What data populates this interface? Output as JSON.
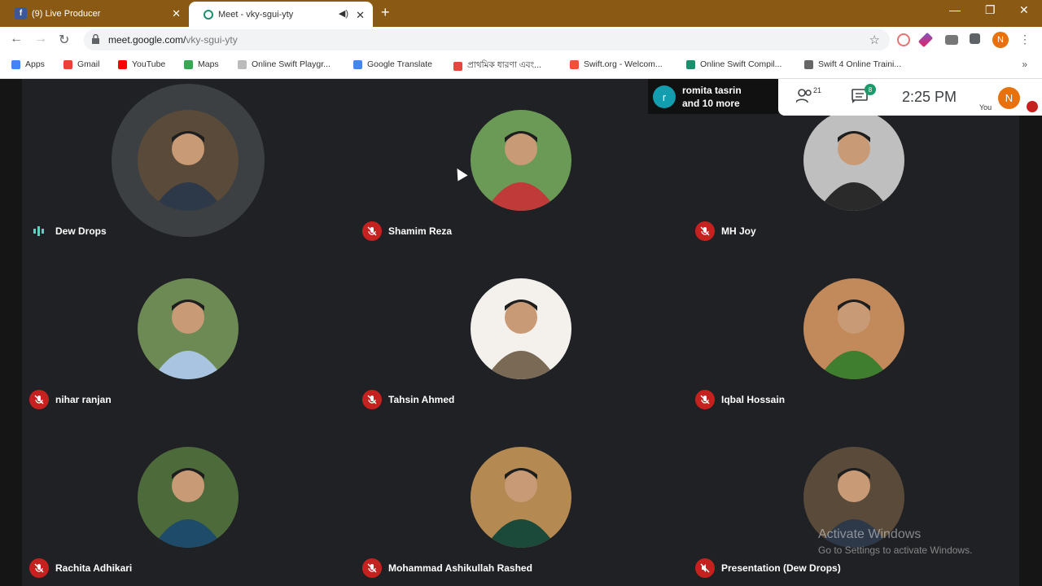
{
  "browser": {
    "tabs": [
      {
        "title": "(9) Live Producer",
        "favicon": "facebook-icon"
      },
      {
        "title": "Meet - vky-sgui-yty",
        "favicon": "meet-icon"
      }
    ],
    "url_host": "meet.google.com/",
    "url_path": "vky-sgui-yty",
    "profile_initial": "N"
  },
  "bookmarks": [
    {
      "label": "Apps",
      "color": "#4285f4"
    },
    {
      "label": "Gmail",
      "color": "#ea4335"
    },
    {
      "label": "YouTube",
      "color": "#ff0000"
    },
    {
      "label": "Maps",
      "color": "#34a853"
    },
    {
      "label": "Online Swift Playgr...",
      "color": "#bbbbbb"
    },
    {
      "label": "Google Translate",
      "color": "#4285f4"
    },
    {
      "label": "প্রাথমিক ধারণা এবং...",
      "color": "#e8453c"
    },
    {
      "label": "Swift.org - Welcom...",
      "color": "#f05138"
    },
    {
      "label": "Online Swift Compil...",
      "color": "#1a8f6b"
    },
    {
      "label": "Swift 4 Online Traini...",
      "color": "#666666"
    }
  ],
  "meeting": {
    "presenter_initial": "r",
    "presenter_line1": "romita tasrin",
    "presenter_line2": "and 10 more",
    "people_count": "21",
    "chat_badge": "8",
    "time": "2:25 PM",
    "you_label": "You",
    "you_initial": "N"
  },
  "participants": [
    {
      "name": "Dew Drops",
      "status": "speaking",
      "bg": "#5a4a3a",
      "fg": "#2d3848"
    },
    {
      "name": "Shamim Reza",
      "status": "muted",
      "bg": "#6a9a56",
      "fg": "#c03a3a"
    },
    {
      "name": "MH Joy",
      "status": "muted",
      "bg": "#bfbfbf",
      "fg": "#2a2a2a"
    },
    {
      "name": "nihar ranjan",
      "status": "muted",
      "bg": "#6d8a55",
      "fg": "#a8c4e0"
    },
    {
      "name": "Tahsin Ahmed",
      "status": "muted",
      "bg": "#f4f1ec",
      "fg": "#7a6a55"
    },
    {
      "name": "Iqbal Hossain",
      "status": "muted",
      "bg": "#c28a5a",
      "fg": "#3f7d2f"
    },
    {
      "name": "Rachita Adhikari",
      "status": "muted",
      "bg": "#4d6a3a",
      "fg": "#1e4b6a"
    },
    {
      "name": "Mohammad Ashikullah Rashed",
      "status": "muted",
      "bg": "#b58a52",
      "fg": "#1b4a3a"
    },
    {
      "name": "Presentation (Dew Drops)",
      "status": "presenting",
      "bg": "#5a4a3a",
      "fg": "#2d3848"
    }
  ],
  "watermark": {
    "line1": "Activate Windows",
    "line2": "Go to Settings to activate Windows."
  }
}
